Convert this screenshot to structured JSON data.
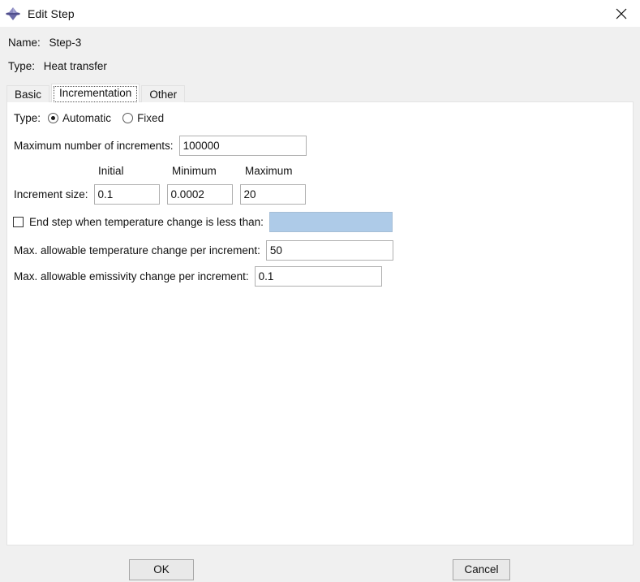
{
  "window": {
    "title": "Edit Step",
    "icon": "abaqus-step-icon",
    "close_icon": "close-icon"
  },
  "header": {
    "name_label": "Name:",
    "name_value": "Step-3",
    "type_label": "Type:",
    "type_value": "Heat transfer"
  },
  "tabs": [
    {
      "label": "Basic",
      "selected": false
    },
    {
      "label": "Incrementation",
      "selected": true
    },
    {
      "label": "Other",
      "selected": false
    }
  ],
  "form": {
    "type_label": "Type:",
    "type_options": [
      {
        "label": "Automatic",
        "checked": true
      },
      {
        "label": "Fixed",
        "checked": false
      }
    ],
    "max_increments_label": "Maximum number of increments:",
    "max_increments_value": "100000",
    "column_headers": {
      "initial": "Initial",
      "minimum": "Minimum",
      "maximum": "Maximum"
    },
    "increment_size_label": "Increment size:",
    "increment_size_initial": "0.1",
    "increment_size_minimum": "0.0002",
    "increment_size_maximum": "20",
    "end_step_label": "End step when temperature change is less than:",
    "end_step_checked": false,
    "end_step_value": "",
    "max_temp_change_label": "Max. allowable temperature change per increment:",
    "max_temp_change_value": "50",
    "max_emissivity_change_label": "Max. allowable emissivity change per increment:",
    "max_emissivity_change_value": "0.1"
  },
  "footer": {
    "ok_label": "OK",
    "cancel_label": "Cancel"
  },
  "colors": {
    "window_bg": "#f0f0f0",
    "titlebar_bg": "#ffffff",
    "panel_bg": "#ffffff",
    "disabled_field": "#aecbe8",
    "icon_purple": "#6b6aa8",
    "button_face": "#e9e9e9"
  }
}
